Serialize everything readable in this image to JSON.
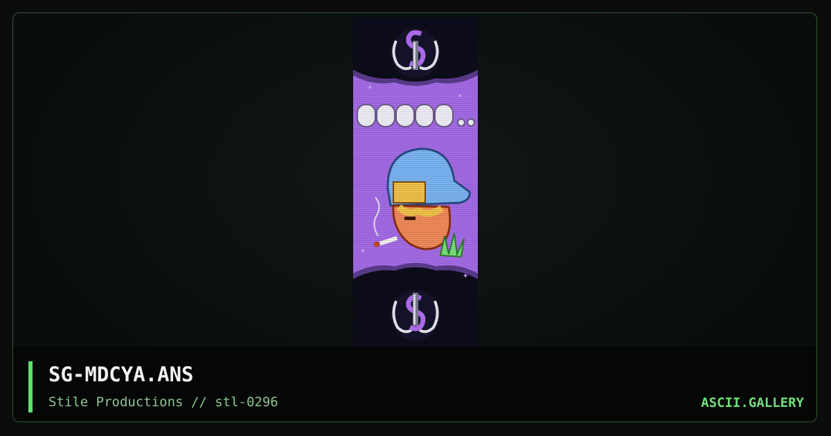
{
  "artwork": {
    "panel_color": "#a46be6",
    "band_color": "#0d0c1a",
    "accent_color": "#5fe06a",
    "emblem_icon": "stile-logo-icon"
  },
  "footer": {
    "title": "SG-MDCYA.ANS",
    "subtitle": "Stile Productions // stl-0296",
    "brand": "ASCII.GALLERY"
  }
}
